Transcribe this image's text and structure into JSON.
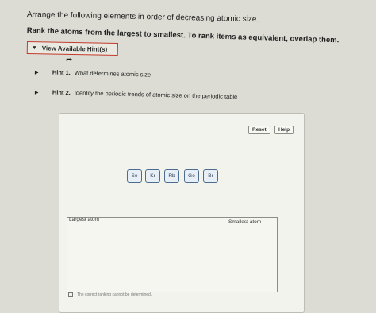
{
  "question": {
    "line1": "Arrange the following elements in order of decreasing atomic size.",
    "instruction": "Rank the atoms from the largest to smallest. To rank items as equivalent, overlap them."
  },
  "hints": {
    "toggle_label": "View Available Hint(s)",
    "items": [
      {
        "prefix": "Hint 1.",
        "text": "What determines atomic size"
      },
      {
        "prefix": "Hint 2.",
        "text": "Identify the periodic trends of atomic size on the periodic table"
      }
    ]
  },
  "toolbar": {
    "reset_label": "Reset",
    "help_label": "Help"
  },
  "atoms": [
    "Se",
    "Kr",
    "Rb",
    "Ge",
    "Br"
  ],
  "ranking": {
    "largest_label": "Largest atom",
    "smallest_label": "Smallest atom",
    "equal_text": "The correct ranking cannot be determined."
  }
}
